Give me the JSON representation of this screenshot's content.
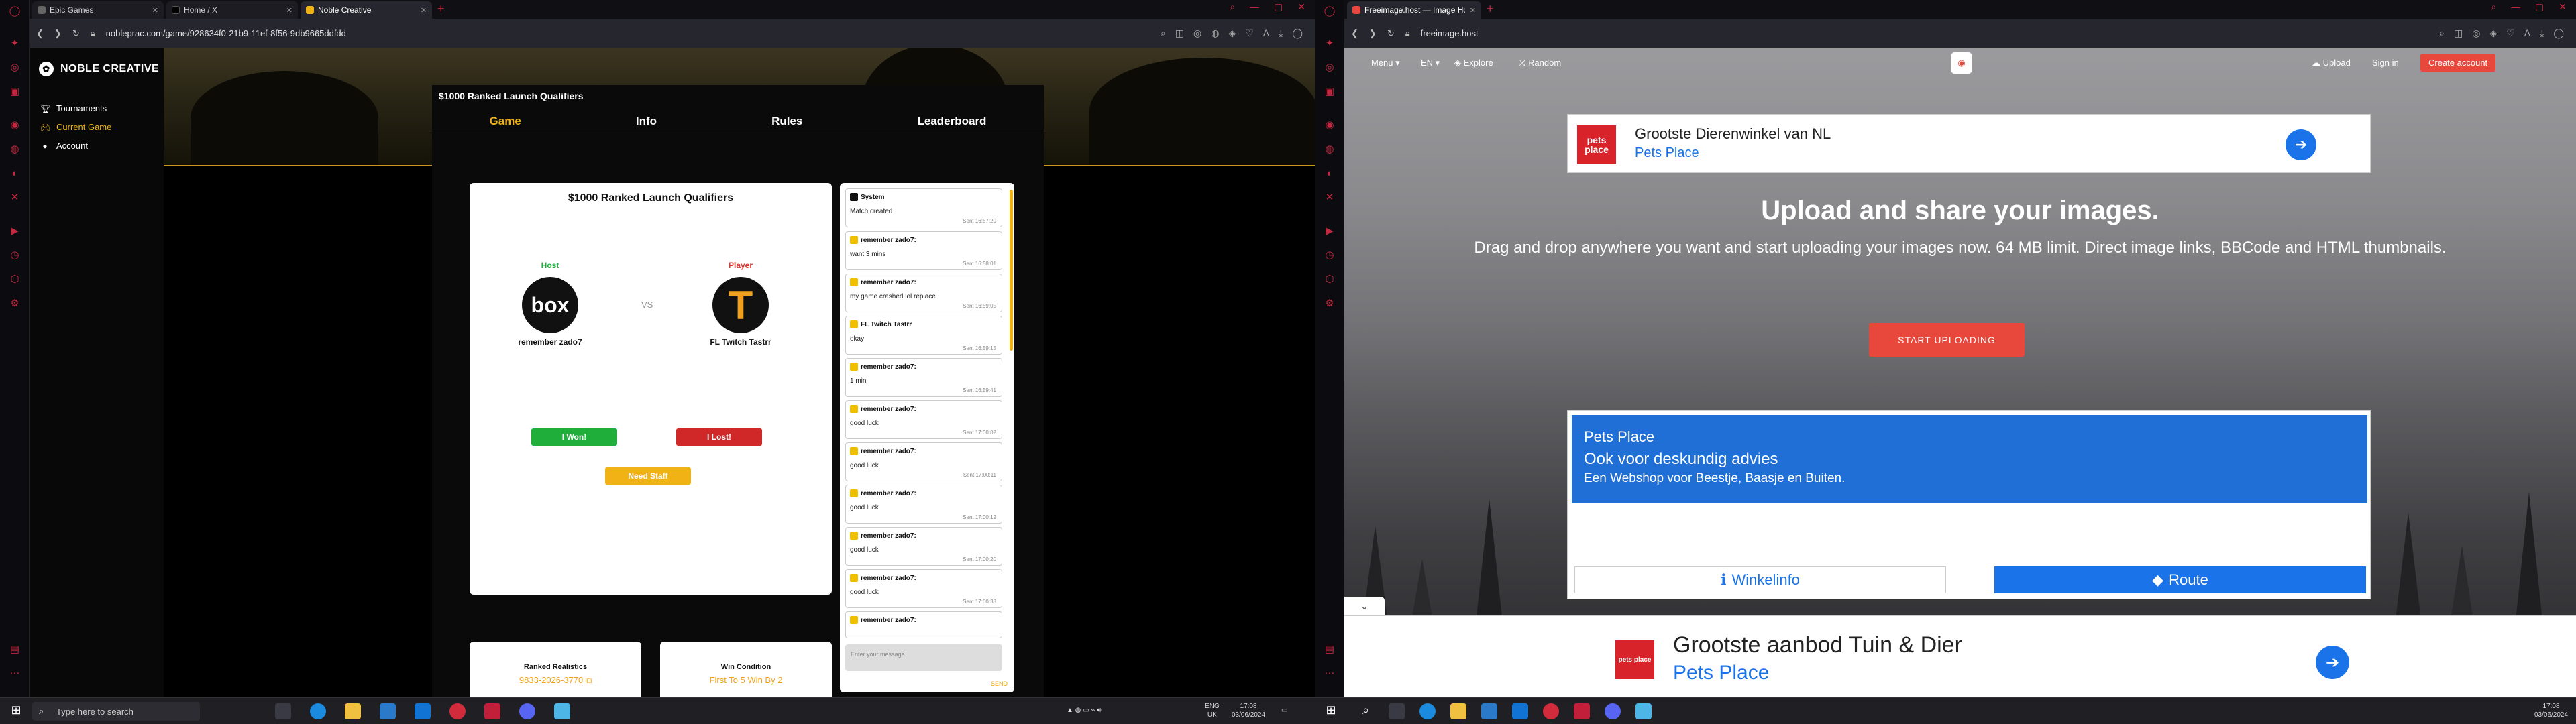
{
  "left": {
    "tabs": [
      {
        "label": "Epic Games",
        "active": false
      },
      {
        "label": "Home / X",
        "active": false
      },
      {
        "label": "Noble Creative",
        "active": true
      }
    ],
    "url": "nobleprac.com/game/928634f0-21b9-11ef-8f56-9db9665ddfdd",
    "brand": "NOBLE CREATIVE",
    "nav": [
      {
        "label": "Tournaments",
        "icon": "trophy-icon",
        "active": false
      },
      {
        "label": "Current Game",
        "icon": "controller-icon",
        "active": true
      },
      {
        "label": "Account",
        "icon": "person-icon",
        "active": false
      }
    ],
    "game_title": "$1000 Ranked Launch Qualifiers",
    "game_tabs": [
      "Game",
      "Info",
      "Rules",
      "Leaderboard"
    ],
    "match": {
      "title": "$1000 Ranked Launch Qualifiers",
      "host_label": "Host",
      "player_label": "Player",
      "vs": "VS",
      "host_name": "remember zado7",
      "player_name": "FL Twitch Tastrr",
      "host_avatar_text": "box",
      "player_avatar_text": "T",
      "won_label": "I Won!",
      "lost_label": "I Lost!",
      "reset_label": "Need Staff"
    },
    "info": [
      {
        "title": "Ranked Realistics",
        "value": "9833-2026-3770 ⧉"
      },
      {
        "title": "Win Condition",
        "value": "First To 5 Win By 2"
      }
    ],
    "chat": {
      "messages": [
        {
          "user": "System",
          "text": "Match created",
          "time": "Sent 16:57:20",
          "system": true
        },
        {
          "user": "remember zado7:",
          "text": "want 3 mins",
          "time": "Sent 16:58:01",
          "system": false
        },
        {
          "user": "remember zado7:",
          "text": "my game crashed lol replace",
          "time": "Sent 16:59:05",
          "system": false
        },
        {
          "user": "FL Twitch Tastrr",
          "text": "okay",
          "time": "Sent 16:59:15",
          "system": false
        },
        {
          "user": "remember zado7:",
          "text": "1 min",
          "time": "Sent 16:59:41",
          "system": false
        },
        {
          "user": "remember zado7:",
          "text": "good luck",
          "time": "Sent 17:00:02",
          "system": false
        },
        {
          "user": "remember zado7:",
          "text": "good luck",
          "time": "Sent 17:00:11",
          "system": false
        },
        {
          "user": "remember zado7:",
          "text": "good luck",
          "time": "Sent 17:00:12",
          "system": false
        },
        {
          "user": "remember zado7:",
          "text": "good luck",
          "time": "Sent 17:00:20",
          "system": false
        },
        {
          "user": "remember zado7:",
          "text": "good luck",
          "time": "Sent 17:00:38",
          "system": false
        },
        {
          "user": "remember zado7:",
          "text": "",
          "time": "",
          "system": false
        }
      ],
      "placeholder": "Enter your message",
      "send_label": "SEND"
    },
    "taskbar": {
      "search_placeholder": "Type here to search",
      "lang": "ENG",
      "region": "UK",
      "time": "17:08",
      "date": "03/06/2024"
    }
  },
  "right": {
    "tab_label": "Freeimage.host — Image Hosting",
    "url": "freeimage.host",
    "nav": {
      "menu": "Menu ▾",
      "lang": "EN ▾",
      "explore": "Explore",
      "random": "Random",
      "upload": "Upload",
      "signin": "Sign in",
      "create": "Create account"
    },
    "ad_top": {
      "brand": "pets place",
      "headline": "Grootste Dierenwinkel van NL",
      "sub": "Pets Place"
    },
    "hero_title": "Upload and share your images.",
    "hero_text": "Drag and drop anywhere you want and start uploading your images now. 64 MB limit. Direct image links, BBCode and HTML thumbnails.",
    "upload_button": "START UPLOADING",
    "ad_mid": {
      "line1": "Pets Place",
      "line2": "Ook voor deskundig advies",
      "line3": "Een Webshop voor Beestje, Baasje en Buiten.",
      "btn1": "Winkelinfo",
      "btn2": "Route"
    },
    "ad_bottom": {
      "brand": "pets place",
      "headline": "Grootste aanbod Tuin & Dier",
      "sub": "Pets Place"
    },
    "taskbar": {
      "time": "17:08",
      "date": "03/06/2024"
    }
  },
  "colors": {
    "accent": "#f0b214",
    "opera_red": "#c42840",
    "fi_red": "#e8473c",
    "ad_blue": "#1a73e8"
  }
}
